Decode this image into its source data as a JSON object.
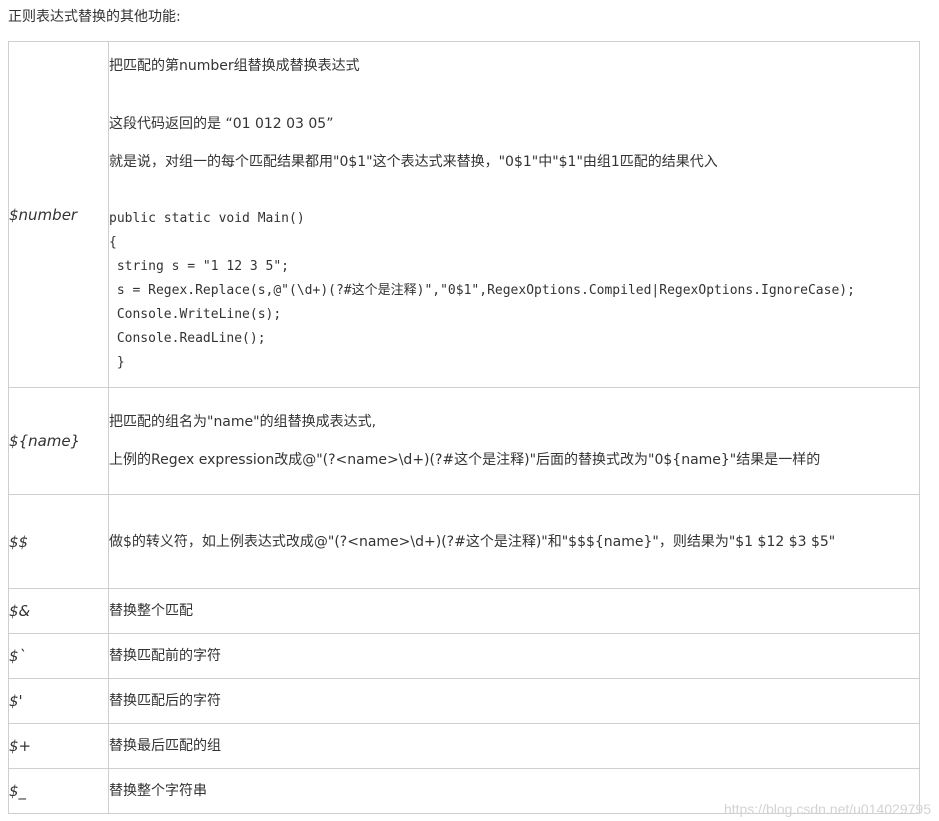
{
  "intro": "正则表达式替换的其他功能:",
  "rows": [
    {
      "symbol": "$number",
      "desc": "把匹配的第number组替换成替换表达式",
      "returns": "这段代码返回的是 “01 012 03 05”",
      "explain": "就是说，对组一的每个匹配结果都用\"0$1\"这个表达式来替换，\"0$1\"中\"$1\"由组1匹配的结果代入",
      "code": [
        "public static void Main()",
        "{",
        " string s = \"1 12 3 5\";",
        " s = Regex.Replace(s,@\"(\\d+)(?#这个是注释)\",\"0$1\",RegexOptions.Compiled|RegexOptions.IgnoreCase);",
        " Console.WriteLine(s);",
        " Console.ReadLine();",
        " }"
      ]
    },
    {
      "symbol": "${name}",
      "desc": "把匹配的组名为\"name\"的组替换成表达式,",
      "desc2": "上例的Regex expression改成@\"(?<name>\\d+)(?#这个是注释)\"后面的替换式改为\"0${name}\"结果是一样的"
    },
    {
      "symbol": "$$",
      "desc": "做$的转义符，如上例表达式改成@\"(?<name>\\d+)(?#这个是注释)\"和\"$$${name}\"，则结果为\"$1 $12 $3 $5\""
    },
    {
      "symbol": "$&",
      "desc": "替换整个匹配"
    },
    {
      "symbol": "$`",
      "desc": "替换匹配前的字符"
    },
    {
      "symbol": "$'",
      "desc": "替换匹配后的字符"
    },
    {
      "symbol": "$+",
      "desc": "替换最后匹配的组"
    },
    {
      "symbol": "$_",
      "desc": "替换整个字符串"
    }
  ],
  "watermark": "https://blog.csdn.net/u014029795"
}
